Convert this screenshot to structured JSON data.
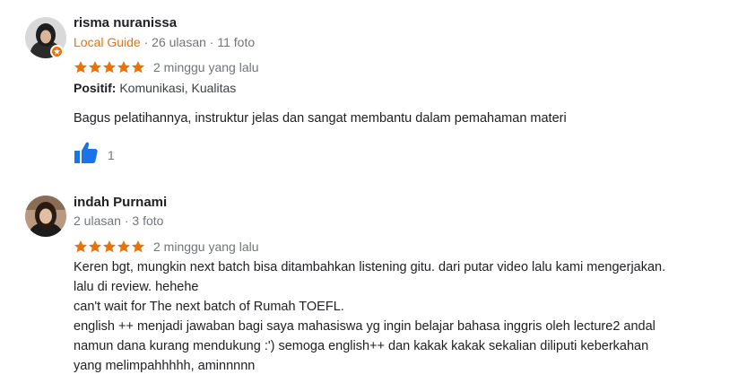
{
  "colors": {
    "star": "#e8710a",
    "local_guide": "#e8710a",
    "like": "#1a73e8",
    "secondary_text": "#70757a"
  },
  "reviews": [
    {
      "author": "risma nuranissa",
      "badge": "Local Guide",
      "review_count": "26 ulasan",
      "separator": "·",
      "photo_count": "11 foto",
      "stars": 5,
      "date": "2 minggu yang lalu",
      "positive_label": "Positif:",
      "positive_value": "Komunikasi, Kualitas",
      "text_lines": [
        "Bagus pelatihannya, instruktur jelas dan sangat membantu dalam pemahaman materi"
      ],
      "like_icon": "thumbs-up-icon",
      "like_count": "1"
    },
    {
      "author": "indah Purnami",
      "review_count": "2 ulasan",
      "separator": "·",
      "photo_count": "3 foto",
      "stars": 5,
      "date": "2 minggu yang lalu",
      "text_lines": [
        "Keren bgt, mungkin next batch bisa ditambahkan listening gitu. dari putar video lalu kami mengerjakan.",
        "lalu di review. hehehe",
        "can't wait for The next batch of Rumah TOEFL.",
        "english ++ menjadi jawaban bagi saya mahasiswa yg ingin belajar bahasa inggris oleh lecture2 andal",
        "namun dana kurang mendukung :') semoga english++ dan kakak kakak sekalian diliputi keberkahan",
        "yang melimpahhhhh, aminnnnn"
      ]
    }
  ]
}
